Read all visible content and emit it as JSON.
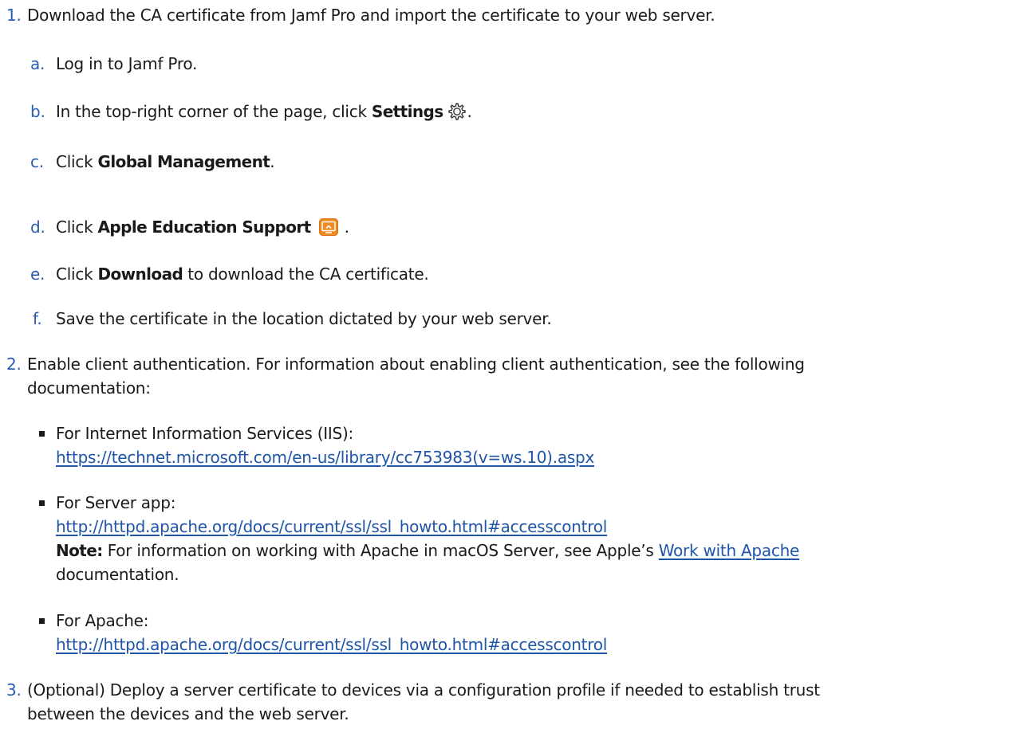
{
  "steps": [
    {
      "number": "1.",
      "text": "Download the CA certificate from Jamf Pro and import the certificate to your web server.",
      "substeps": [
        {
          "letter": "a.",
          "text": "Log in to Jamf Pro."
        },
        {
          "letter": "b.",
          "pre": "In the top-right corner of the page, click ",
          "bold": "Settings",
          "post": "."
        },
        {
          "letter": "c.",
          "pre": "Click ",
          "bold": "Global Management",
          "post": "."
        },
        {
          "letter": "d.",
          "pre": "Click ",
          "bold": "Apple Education Support",
          "post": "."
        },
        {
          "letter": "e.",
          "pre": "Click ",
          "bold": "Download",
          "post": " to download the CA certificate."
        },
        {
          "letter": "f.",
          "text": "Save the certificate in the location dictated by your web server."
        }
      ]
    },
    {
      "number": "2.",
      "line1": "Enable client authentication. For information about enabling client authentication, see the following",
      "line2": "documentation:",
      "bullets": [
        {
          "label": "For Internet Information Services (IIS):",
          "url": "https://technet.microsoft.com/en-us/library/cc753983(v=ws.10).aspx"
        },
        {
          "label": "For Server app:",
          "url": "http://httpd.apache.org/docs/current/ssl/ssl_howto.html#accesscontrol",
          "note_label": "Note:",
          "note_pre": " For information on working with Apache in macOS Server, see Apple’s ",
          "note_link": "Work with Apache",
          "note_post": "documentation."
        },
        {
          "label": "For Apache:",
          "url": "http://httpd.apache.org/docs/current/ssl/ssl_howto.html#accesscontrol"
        }
      ]
    },
    {
      "number": "3.",
      "line1": "(Optional) Deploy a server certificate to devices via a configuration profile if needed to establish trust",
      "line2": "between the devices and the web server."
    }
  ],
  "colors": {
    "number": "#2a5db0",
    "link": "#1f55a8",
    "text": "#1a1a1a",
    "icon_orange": "#f08a1e"
  },
  "icons": {
    "settings": "gear-icon",
    "apple_education_support": "apple-education-support-icon"
  }
}
